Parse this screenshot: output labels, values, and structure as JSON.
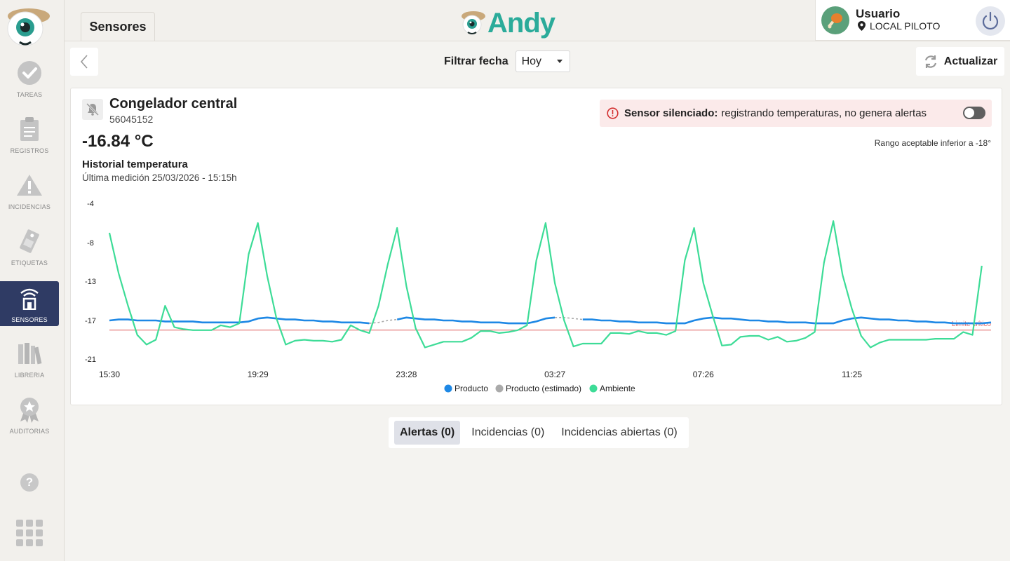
{
  "header": {
    "page_tab": "Sensores",
    "brand": "Andy",
    "user": {
      "name": "Usuario",
      "location": "LOCAL PILOTO"
    }
  },
  "sidebar": {
    "items": [
      {
        "label": "TAREAS",
        "icon": "check-circle-icon",
        "active": false
      },
      {
        "label": "REGISTROS",
        "icon": "clipboard-icon",
        "active": false
      },
      {
        "label": "INCIDENCIAS",
        "icon": "warning-icon",
        "active": false
      },
      {
        "label": "ETIQUETAS",
        "icon": "label-icon",
        "active": false
      },
      {
        "label": "SENSORES",
        "icon": "sensor-wifi-icon",
        "active": true
      },
      {
        "label": "LIBRERIA",
        "icon": "books-icon",
        "active": false
      },
      {
        "label": "AUDITORIAS",
        "icon": "award-icon",
        "active": false
      }
    ],
    "help": "?"
  },
  "toolbar": {
    "filter_label": "Filtrar fecha",
    "filter_value": "Hoy",
    "refresh_label": "Actualizar"
  },
  "sensor": {
    "name": "Congelador central",
    "id": "56045152",
    "temperature": "-16.84 °C",
    "alert_bold": "Sensor silenciado:",
    "alert_text": "registrando temperaturas, no genera alertas",
    "range_note": "Rango aceptable inferior a -18°",
    "history_title": "Historial temperatura",
    "last_measure": "Última medición 25/03/2026 - 15:15h"
  },
  "chart_data": {
    "type": "line",
    "x_tick_labels": [
      "15:30",
      "19:29",
      "23:28",
      "03:27",
      "07:26",
      "11:25"
    ],
    "y_tick_labels": [
      "-4",
      "-8",
      "-13",
      "-17",
      "-21"
    ],
    "ylim": [
      -21,
      -4
    ],
    "critical_limit": {
      "label": "Limite crítico",
      "value": -18,
      "color": "#e06060"
    },
    "legend_position": "bottom-center",
    "series": [
      {
        "name": "Producto",
        "color": "#1e88e5",
        "values": [
          -17.0,
          -16.9,
          -16.9,
          -17.0,
          -17.0,
          -17.0,
          -17.1,
          -17.1,
          -17.1,
          -17.1,
          -17.2,
          -17.2,
          -17.2,
          -17.2,
          -17.2,
          -17.1,
          -16.8,
          -16.7,
          -16.8,
          -16.9,
          -16.9,
          -17.0,
          -17.0,
          -17.1,
          -17.1,
          -17.2,
          -17.2,
          -17.2,
          -17.3,
          null,
          null,
          -16.9,
          -16.7,
          -16.8,
          -16.9,
          -16.9,
          -17.0,
          -17.0,
          -17.1,
          -17.1,
          -17.2,
          -17.2,
          -17.2,
          -17.3,
          -17.3,
          -17.3,
          -17.1,
          -16.8,
          -16.7,
          null,
          null,
          -16.9,
          -16.9,
          -17.0,
          -17.0,
          -17.1,
          -17.1,
          -17.2,
          -17.2,
          -17.2,
          -17.3,
          -17.3,
          -17.3,
          -17.0,
          -16.8,
          -16.7,
          -16.8,
          -16.8,
          -16.9,
          -17.0,
          -17.0,
          -17.1,
          -17.1,
          -17.2,
          -17.2,
          -17.2,
          -17.3,
          -17.3,
          -17.3,
          -17.0,
          -16.8,
          -16.7,
          -16.8,
          -16.9,
          -16.9,
          -17.0,
          -17.0,
          -17.1,
          -17.1,
          -17.2,
          -17.2,
          -17.3,
          -17.3,
          -17.3,
          -17.3,
          -17.2
        ]
      },
      {
        "name": "Producto (estimado)",
        "color": "#aaaaaa",
        "values": [
          null,
          null,
          null,
          null,
          null,
          null,
          null,
          null,
          null,
          null,
          null,
          null,
          null,
          null,
          null,
          null,
          null,
          null,
          null,
          null,
          null,
          null,
          null,
          null,
          null,
          null,
          null,
          null,
          -17.3,
          -17.2,
          -17.0,
          -16.9,
          null,
          null,
          null,
          null,
          null,
          null,
          null,
          null,
          null,
          null,
          null,
          null,
          null,
          null,
          null,
          null,
          -16.7,
          -16.7,
          -16.8,
          -16.9,
          null,
          null,
          null,
          null,
          null,
          null,
          null,
          null,
          null,
          null,
          null,
          null,
          null,
          null,
          null,
          null,
          null,
          null,
          null,
          null,
          null,
          null,
          null,
          null,
          null,
          null,
          null,
          null,
          null,
          null,
          null,
          null,
          null,
          null,
          null,
          null,
          null,
          null,
          null,
          null,
          null,
          null,
          null,
          null
        ]
      },
      {
        "name": "Ambiente",
        "color": "#3ddc97",
        "values": [
          -7,
          -12,
          -15.5,
          -18.5,
          -19.5,
          -19,
          -15.5,
          -17.7,
          -17.9,
          -18,
          -18,
          -18,
          -17.5,
          -17.7,
          -17.3,
          -9.5,
          -6,
          -12.3,
          -16.8,
          -19.5,
          -19.1,
          -19,
          -19.1,
          -19.1,
          -19.2,
          -19,
          -17.5,
          -18,
          -18.3,
          -15.5,
          -10.8,
          -6.5,
          -13.5,
          -17.8,
          -19.8,
          -19.5,
          -19.2,
          -19.2,
          -19.2,
          -18.8,
          -18.1,
          -18.1,
          -18.3,
          -18.2,
          -18,
          -17.5,
          -10.3,
          -6,
          -13.2,
          -17,
          -19.7,
          -19.4,
          -19.4,
          -19.4,
          -18.3,
          -18.3,
          -18.4,
          -18.1,
          -18.3,
          -18.3,
          -18.5,
          -18.1,
          -10.3,
          -6.5,
          -13.2,
          -16.5,
          -19.6,
          -19.5,
          -18.7,
          -18.6,
          -18.6,
          -19,
          -18.7,
          -19.2,
          -19.1,
          -18.8,
          -18.2,
          -10.6,
          -5.8,
          -12.2,
          -15.8,
          -18.6,
          -19.8,
          -19.3,
          -19,
          -19,
          -19,
          -19,
          -19,
          -18.9,
          -18.9,
          -18.9,
          -18.2,
          -18.5,
          -11
        ]
      }
    ]
  },
  "bottom_tabs": [
    {
      "label": "Alertas (0)",
      "active": true
    },
    {
      "label": "Incidencias (0)",
      "active": false
    },
    {
      "label": "Incidencias abiertas (0)",
      "active": false
    }
  ]
}
